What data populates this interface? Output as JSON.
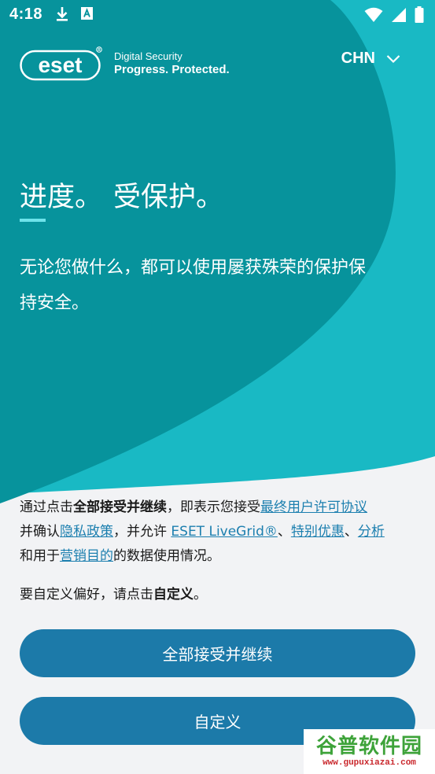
{
  "status_bar": {
    "time": "4:18",
    "left_icons": [
      "download-icon",
      "keyboard-a-icon"
    ],
    "right_icons": [
      "wifi-icon",
      "signal-icon",
      "battery-icon"
    ]
  },
  "brand": {
    "logo_text": "eset",
    "tagline_line1": "Digital Security",
    "tagline_line2": "Progress. Protected."
  },
  "language": {
    "selected": "CHN"
  },
  "hero": {
    "headline_part1": "进度。",
    "headline_part2": "受保护。",
    "subline1": "无论您做什么，都可以使用屡获殊荣的保护保",
    "subline2": "持安全。"
  },
  "legal": {
    "t1": "通过点击",
    "b1": "全部接受并继续",
    "t2": "，即表示您接受",
    "link_eula": "最终用户许可协议",
    "t3": "并确认",
    "link_privacy": "隐私政策",
    "t4": "，并允许 ",
    "link_livegrid": "ESET LiveGrid®",
    "t5": "、",
    "link_offers": "特别优惠",
    "t6": "、",
    "link_analytics": "分析",
    "t7": "和用于",
    "link_marketing": "营销目的",
    "t8": "的数据使用情况。"
  },
  "preferences": {
    "t1": "要自定义偏好，请点击",
    "b1": "自定义",
    "t2": "。"
  },
  "buttons": {
    "accept_all": "全部接受并继续",
    "customize": "自定义"
  },
  "watermark": {
    "top": "谷普软件园",
    "bottom": "www.gupuxiazai.com"
  },
  "colors": {
    "teal_dark": "#07939c",
    "teal_light": "#19b9c4",
    "button_blue": "#1c7aa9",
    "link_blue": "#1c7faf",
    "background": "#f2f3f5"
  }
}
